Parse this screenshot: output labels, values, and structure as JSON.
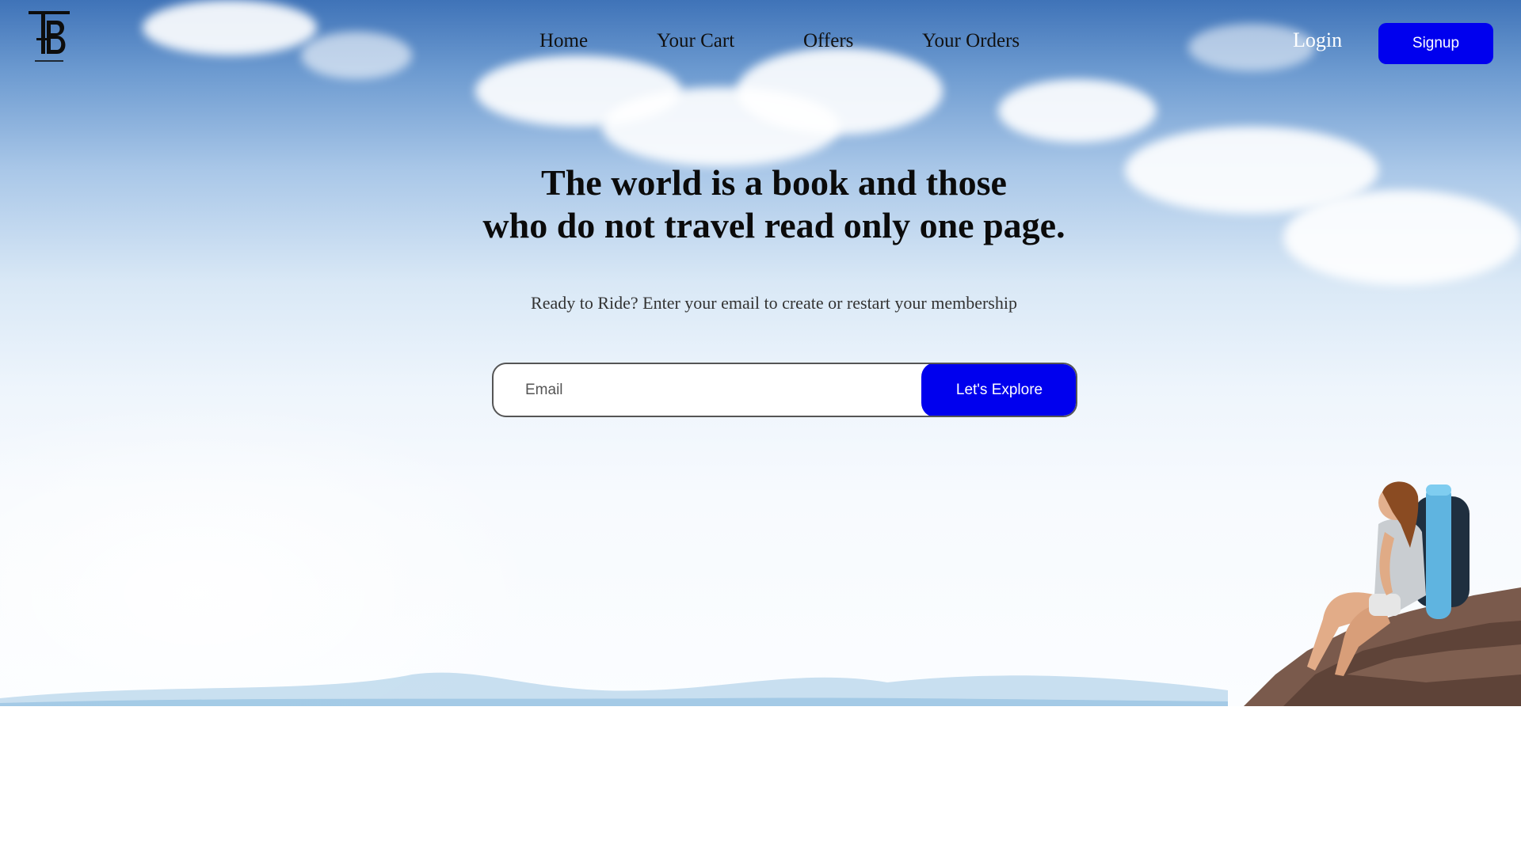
{
  "brand": {
    "logo_icon": "tb-monogram-logo"
  },
  "nav": {
    "items": [
      {
        "label": "Home"
      },
      {
        "label": "Your Cart"
      },
      {
        "label": "Offers"
      },
      {
        "label": "Your Orders"
      }
    ],
    "login_label": "Login",
    "signup_label": "Signup"
  },
  "hero": {
    "headline_line1": "The world is a book and those",
    "headline_line2": "who do not travel read only one page.",
    "subtext": "Ready to Ride? Enter your email to create or restart your membership",
    "email_placeholder": "Email",
    "cta_label": "Let's Explore"
  },
  "colors": {
    "accent": "#0000ee",
    "headline": "#0b0b0b",
    "nav_text": "#111111",
    "login_text": "#ffffff"
  }
}
